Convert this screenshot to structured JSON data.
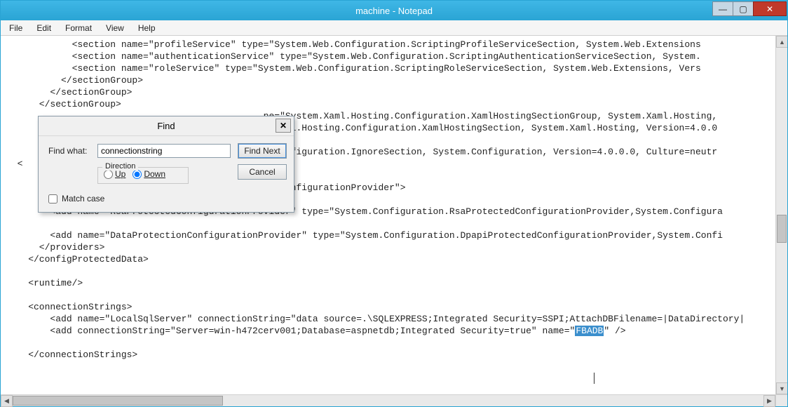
{
  "window": {
    "title": "machine - Notepad"
  },
  "menu": {
    "file": "File",
    "edit": "Edit",
    "format": "Format",
    "view": "View",
    "help": "Help"
  },
  "winbtn": {
    "min": "—",
    "max": "▢",
    "close": "✕"
  },
  "find": {
    "title": "Find",
    "close": "✕",
    "label_find_what": "Find what:",
    "value": "connectionstring",
    "btn_find_next": "Find Next",
    "btn_cancel": "Cancel",
    "direction_legend": "Direction",
    "opt_up": "Up",
    "opt_down": "Down",
    "chk_match_case": "Match case"
  },
  "scroll": {
    "up": "▲",
    "down": "▼",
    "left": "◀",
    "right": "▶"
  },
  "code": {
    "l1": "            <section name=\"profileService\" type=\"System.Web.Configuration.ScriptingProfileServiceSection, System.Web.Extensions",
    "l2": "            <section name=\"authenticationService\" type=\"System.Web.Configuration.ScriptingAuthenticationServiceSection, System.",
    "l3": "            <section name=\"roleService\" type=\"System.Web.Configuration.ScriptingRoleServiceSection, System.Web.Extensions, Vers",
    "l4": "          </sectionGroup>",
    "l5": "        </sectionGroup>",
    "l6": "      </sectionGroup>",
    "l7a": "                                               pe=\"System.Xaml.Hosting.Configuration.XamlHostingSectionGroup, System.Xaml.Hosting,",
    "l7b": "                                               m.Xaml.Hosting.Configuration.XamlHostingSection, System.Xaml.Hosting, Version=4.0.0",
    "l7c": "",
    "l7d": "                                               m.Configuration.IgnoreSection, System.Configuration, Version=4.0.0.0, Culture=neutr",
    "l7e": "  <",
    "l7f": "",
    "l7g": "                                               tedConfigurationProvider\">",
    "l8": "",
    "l9": "        <add name=\"RsaProtectedConfigurationProvider\" type=\"System.Configuration.RsaProtectedConfigurationProvider,System.Configura",
    "l10": "",
    "l11": "        <add name=\"DataProtectionConfigurationProvider\" type=\"System.Configuration.DpapiProtectedConfigurationProvider,System.Confi",
    "l12": "      </providers>",
    "l13": "    </configProtectedData>",
    "l14": "",
    "l15": "    <runtime/>",
    "l16": "",
    "l17": "    <connectionStrings>",
    "l18": "        <add name=\"LocalSqlServer\" connectionString=\"data source=.\\SQLEXPRESS;Integrated Security=SSPI;AttachDBFilename=|DataDirectory|",
    "l19a": "        <add connectionString=\"Server=win-h472cerv001;Database=aspnetdb;Integrated Security=true\" name=\"",
    "l19hl": "FBADB",
    "l19b": "\" />",
    "l20": "",
    "l21": "    </connectionStrings>"
  }
}
